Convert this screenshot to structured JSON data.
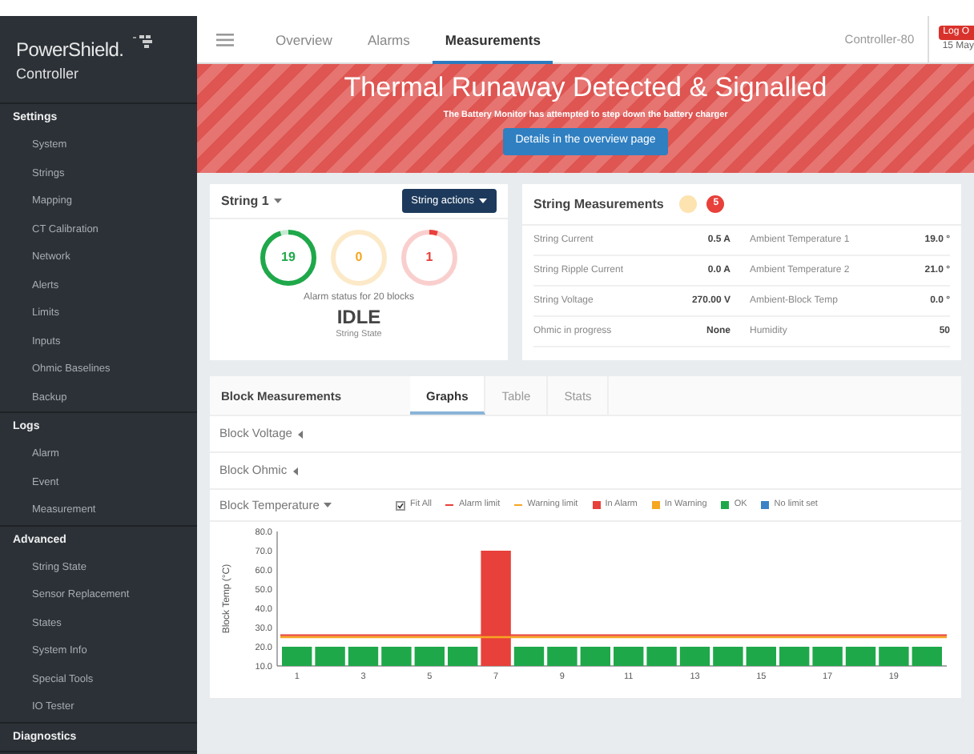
{
  "sidebar": {
    "brand": "PowerShield.",
    "subtitle": "Controller",
    "sections": [
      {
        "title": "Settings",
        "items": [
          "System",
          "Strings",
          "Mapping",
          "CT Calibration",
          "Network",
          "Alerts",
          "Limits",
          "Inputs",
          "Ohmic Baselines",
          "Backup"
        ]
      },
      {
        "title": "Logs",
        "items": [
          "Alarm",
          "Event",
          "Measurement"
        ]
      },
      {
        "title": "Advanced",
        "items": [
          "String State",
          "Sensor Replacement",
          "States",
          "System Info",
          "Special Tools",
          "IO Tester"
        ]
      },
      {
        "title": "Diagnostics"
      }
    ]
  },
  "nav": {
    "tabs": [
      {
        "label": "Overview",
        "selected": false
      },
      {
        "label": "Alarms",
        "selected": false
      },
      {
        "label": "Measurements",
        "selected": true
      }
    ],
    "controller": "Controller-80",
    "logout": "Log O",
    "date": "15 May"
  },
  "banner": {
    "title": "Thermal Runaway Detected & Signalled",
    "message": "The Battery Monitor has attempted to step down the battery charger",
    "button": "Details in the overview page"
  },
  "string_card": {
    "title": "String 1",
    "actions": "String actions",
    "gauges": [
      {
        "value": "19",
        "color": "#1fa84a",
        "level": 0.95
      },
      {
        "value": "0",
        "color": "#f5a623",
        "level": 0
      },
      {
        "value": "1",
        "color": "#e8403a",
        "level": 0.05
      }
    ],
    "caption": "Alarm status for 20 blocks",
    "state": "IDLE",
    "state_label": "String State"
  },
  "measurements": {
    "title": "String Measurements",
    "badges": [
      {
        "color": "#fde3b0"
      },
      {
        "text": "5",
        "color": "#e8403a"
      }
    ],
    "rows": [
      {
        "label": "String Current",
        "value": "0.5 A",
        "label_2": "Ambient Temperature 1",
        "value_2": "19.0 °"
      },
      {
        "label": "String Ripple Current",
        "value": "0.0 A",
        "label_2": "Ambient Temperature 2",
        "value_2": "21.0 °"
      },
      {
        "label": "String Voltage",
        "value": "270.00 V",
        "label_2": "Ambient-Block Temp",
        "value_2": "0.0 °"
      },
      {
        "label": "Ohmic in progress",
        "value": "None",
        "label_2": "Humidity",
        "value_2": "50"
      }
    ]
  },
  "blocks": {
    "title": "Block Measurements",
    "tabs": [
      {
        "label": "Graphs",
        "selected": true
      },
      {
        "label": "Table",
        "selected": false
      },
      {
        "label": "Stats",
        "selected": false
      }
    ],
    "sections": [
      {
        "title": "Block Voltage",
        "expanded": false
      },
      {
        "title": "Block Ohmic",
        "expanded": false
      },
      {
        "title": "Block Temperature",
        "expanded": true
      }
    ],
    "fit_all": {
      "label": "Fit All",
      "checked": true
    },
    "chart_data": {
      "type": "bar",
      "ylabel": "Block Temp (°C)",
      "categories": [
        "1",
        null,
        "3",
        null,
        "5",
        null,
        "7",
        null,
        "9",
        null,
        "11",
        null,
        "13",
        null,
        "15",
        null,
        "17",
        null,
        "19",
        null
      ],
      "series": [
        {
          "name": "In Alarm",
          "color": "#e8403a",
          "values": [
            null,
            null,
            null,
            null,
            null,
            null,
            70,
            null,
            null,
            null,
            null,
            null,
            null,
            null,
            null,
            null,
            null,
            null,
            null,
            null
          ]
        },
        {
          "name": "In Warning",
          "color": "#f5a623",
          "values": [
            null,
            null,
            null,
            null,
            null,
            null,
            null,
            null,
            null,
            null,
            null,
            null,
            null,
            null,
            null,
            null,
            null,
            null,
            null,
            null
          ]
        },
        {
          "name": "OK",
          "color": "#1fa84a",
          "values": [
            20,
            20,
            20,
            20,
            20,
            20,
            null,
            20,
            20,
            20,
            20,
            20,
            20,
            20,
            20,
            20,
            20,
            20,
            20,
            20
          ]
        },
        {
          "name": "No limit set",
          "color": "#3b82c4",
          "values": [
            null,
            null,
            null,
            null,
            null,
            null,
            null,
            null,
            null,
            null,
            null,
            null,
            null,
            null,
            null,
            null,
            null,
            null,
            null,
            null
          ]
        }
      ],
      "ylim": [
        10,
        80
      ],
      "yticks": [
        {
          "value": 10,
          "label": "10.0"
        },
        {
          "value": 20,
          "label": "20.0"
        },
        {
          "value": 30,
          "label": "30.0"
        },
        {
          "value": 40,
          "label": "40.0"
        },
        {
          "value": 50,
          "label": "50.0"
        },
        {
          "value": 60,
          "label": "60.0"
        },
        {
          "value": 70,
          "label": "70.0"
        },
        {
          "value": 80,
          "label": "80.0"
        }
      ],
      "ref_lines": [
        {
          "axis": "y",
          "value": 26,
          "color": "#e8403a",
          "label": "Alarm limit"
        },
        {
          "axis": "y",
          "value": 25,
          "color": "#f5a623",
          "label": "Warning limit"
        }
      ]
    }
  }
}
